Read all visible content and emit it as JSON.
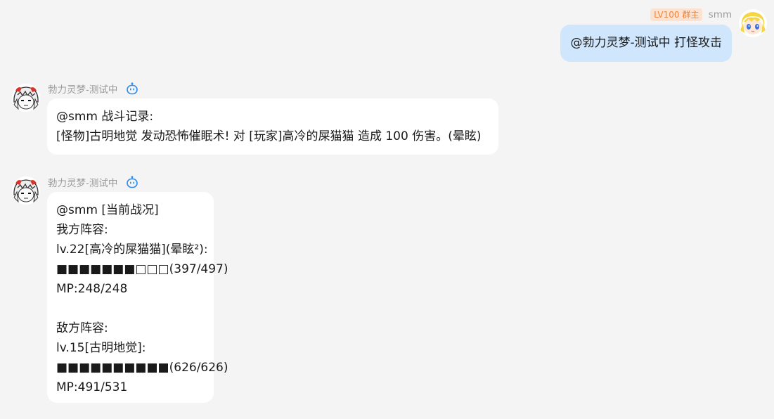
{
  "colors": {
    "background": "#f4f4f4",
    "self_bubble": "#cfe6fd",
    "other_bubble": "#ffffff",
    "badge_bg": "#fde3cf",
    "badge_text": "#f0833c",
    "bot_icon": "#2d8cf0"
  },
  "self_message": {
    "badge": "LV100 群主",
    "sender": "smm",
    "text": "@勃力灵梦-测试中 打怪攻击",
    "avatar_icon": "blonde-anime-avatar-icon"
  },
  "bot_message_1": {
    "sender": "勃力灵梦-测试中",
    "sender_icon": "bot-icon",
    "avatar_icon": "white-hair-anime-avatar-icon",
    "lines": [
      "@smm 战斗记录:",
      "[怪物]古明地觉 发动恐怖催眠术! 对 [玩家]高冷的屎猫猫 造成 100 伤害。(晕眩)"
    ]
  },
  "bot_message_2": {
    "sender": "勃力灵梦-测试中",
    "sender_icon": "bot-icon",
    "avatar_icon": "white-hair-anime-avatar-icon",
    "lines": [
      "@smm [当前战况]",
      "我方阵容:",
      "lv.22[高冷的屎猫猫](晕眩²):",
      "■■■■■■■□□□(397/497)",
      "MP:248/248",
      "",
      "敌方阵容:",
      "lv.15[古明地觉]:",
      "■■■■■■■■■■(626/626)",
      "MP:491/531"
    ]
  }
}
